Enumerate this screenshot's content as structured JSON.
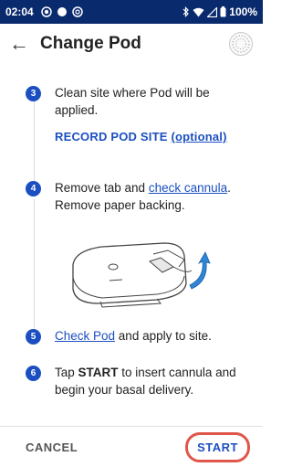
{
  "status_bar": {
    "time": "02:04",
    "battery": "100%"
  },
  "header": {
    "title": "Change Pod"
  },
  "steps": [
    {
      "number": "3",
      "text": "Clean site where Pod will be applied.",
      "record_label": "RECORD POD SITE",
      "record_optional": "(optional)"
    },
    {
      "number": "4",
      "text_pre": "Remove tab and ",
      "link": "check cannula",
      "text_post": ". Remove paper backing."
    },
    {
      "number": "5",
      "link": "Check Pod",
      "text_post": " and apply to site."
    },
    {
      "number": "6",
      "text_pre": "Tap ",
      "bold": "START",
      "text_post": " to insert cannula and begin your basal delivery."
    }
  ],
  "footer": {
    "cancel_label": "CANCEL",
    "start_label": "START"
  },
  "colors": {
    "status_bar": "#0a2a6e",
    "accent": "#1b4fc1",
    "highlight_ring": "#e0564a"
  },
  "icons": [
    "record-dot-icon",
    "circle-icon",
    "circle-at-icon",
    "bluetooth-icon",
    "wifi-icon",
    "signal-icon",
    "battery-icon",
    "back-arrow-icon",
    "pod-icon"
  ]
}
